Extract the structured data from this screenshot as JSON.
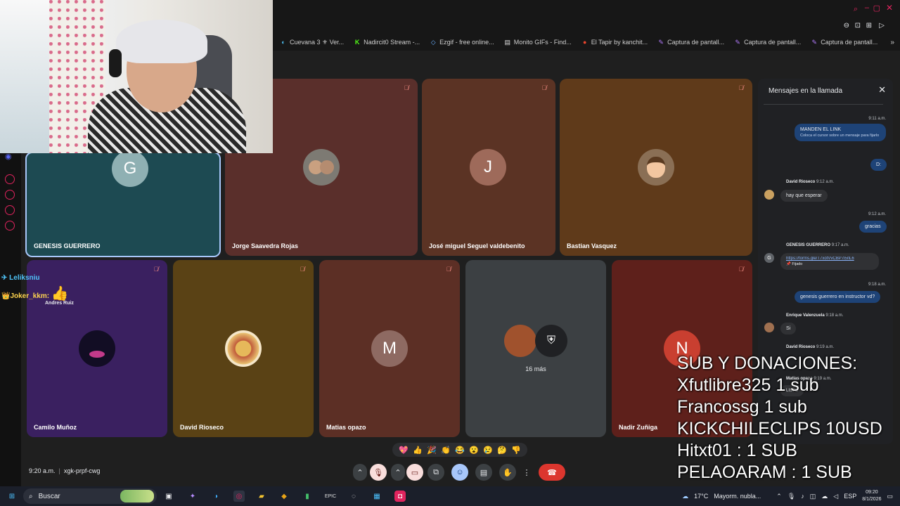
{
  "bookmarks": [
    {
      "icon": "cuevana-icon",
      "label": "Cuevana 3 ⚜ Ver..."
    },
    {
      "icon": "kick-icon",
      "label": "Nadircit0 Stream -..."
    },
    {
      "icon": "ezgif-icon",
      "label": "Ezgif - free online..."
    },
    {
      "icon": "page-icon",
      "label": "Monito GIFs - Find..."
    },
    {
      "icon": "tapir-icon",
      "label": "El Tapir by kanchit..."
    },
    {
      "icon": "capture-icon",
      "label": "Captura de pantall..."
    },
    {
      "icon": "capture-icon",
      "label": "Captura de pantall..."
    },
    {
      "icon": "capture-icon",
      "label": "Captura de pantall..."
    }
  ],
  "tiles_row1": [
    {
      "name": "GENESIS GUERRERO",
      "initial": "G",
      "bg": "#1d4a52",
      "avatar_bg": "#8fb0b3"
    },
    {
      "name": "Jorge Saavedra Rojas",
      "initial": "",
      "bg": "#5a2f2b"
    },
    {
      "name": "José miguel Seguel valdebenito",
      "initial": "J",
      "bg": "#5b3324",
      "avatar_bg": "#9e6a5a"
    },
    {
      "name": "Bastian Vasquez",
      "initial": "",
      "bg": "#5f3a1a"
    }
  ],
  "tiles_row2": [
    {
      "name": "Camilo Muñoz",
      "initial": "",
      "bg": "#3a2060"
    },
    {
      "name": "David Rioseco",
      "initial": "",
      "bg": "#5a4215"
    },
    {
      "name": "Matias opazo",
      "initial": "M",
      "bg": "#5c2f25",
      "avatar_bg": "#8e6a62"
    },
    {
      "name": "",
      "initial": "",
      "bg": "#3c4043",
      "more": "16 más"
    },
    {
      "name": "Nadir Zuñiga",
      "initial": "N",
      "bg": "#5e201b",
      "avatar_bg": "#c93f30"
    }
  ],
  "overlay": {
    "user1": "Leliksniu",
    "user2": "Joker_kkm:",
    "sub_name": "Andres Ruiz"
  },
  "chat": {
    "title": "Mensajes en la llamada",
    "messages": [
      {
        "time": "9:11 a.m.",
        "text": "MANDEN EL LINK",
        "hint": "Coloca el cursor sobre un mensaje para fijarlo"
      },
      {
        "text": "D:"
      },
      {
        "name": "David Rioseco",
        "time": "9:12 a.m.",
        "text": "hay que esperar"
      },
      {
        "time": "9:12 a.m.",
        "text": "gracias"
      },
      {
        "name": "GENESIS GUERRERO",
        "time": "9:17 a.m.",
        "text": "https://forms.gle/T7xotVvCBP7i5nL6",
        "pinned": "Fijado"
      },
      {
        "time": "9:18 a.m.",
        "text": "genesis guerrero en instructor vd?"
      },
      {
        "name": "Enrique Valenzuela",
        "time": "9:18 a.m.",
        "text": "Si"
      },
      {
        "name": "David Rioseco",
        "time": "9:19 a.m.",
        "text": ""
      },
      {
        "name": "Matias opazo",
        "time": "9:19 a.m.",
        "text": "LISTO"
      }
    ]
  },
  "meeting": {
    "time": "9:20 a.m.",
    "code": "xgk-prpf-cwg"
  },
  "reactions": [
    "💖",
    "👍",
    "🎉",
    "👏",
    "😂",
    "😮",
    "😢",
    "🤔",
    "👎"
  ],
  "donations": {
    "lines": [
      "SUB Y DONACIONES:",
      "Xfutlibre325 1 sub",
      "Francossg 1 sub",
      "KICKCHILECLIPS 10USD",
      "Hitxt01 : 1 SUB",
      "PELAOARAM : 1 SUB"
    ]
  },
  "taskbar": {
    "search_placeholder": "Buscar",
    "weather": "17°C",
    "weather_desc": "Mayorm. nubla...",
    "lang": "ESP",
    "clock_time": "09:20",
    "clock_date": "8/1/2026"
  }
}
